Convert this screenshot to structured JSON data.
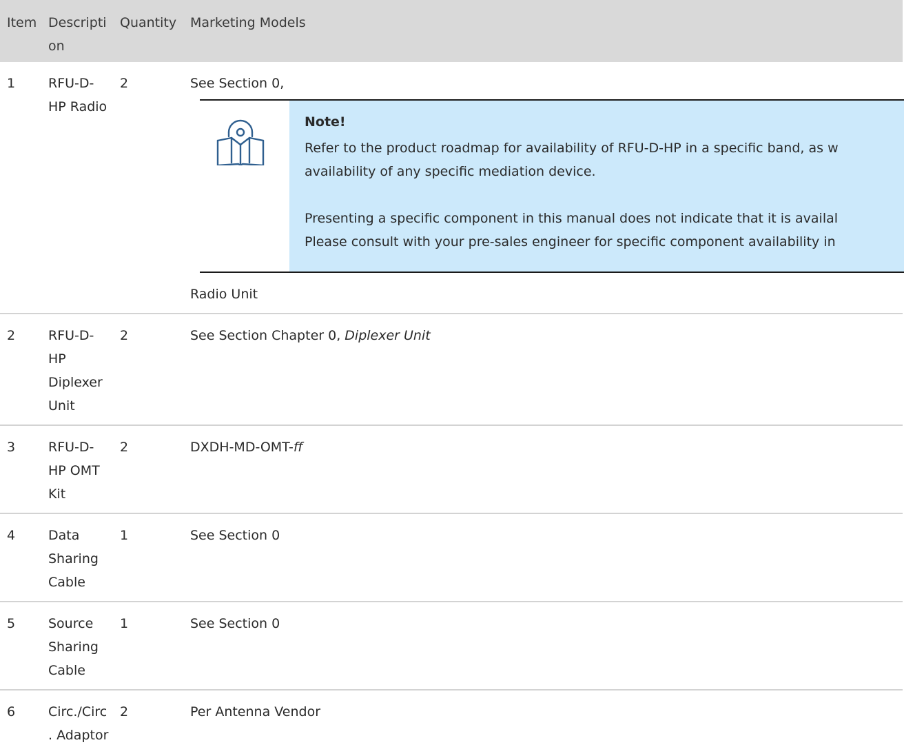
{
  "table": {
    "headers": {
      "item": "Item",
      "description": "Description",
      "quantity": "Quantity",
      "models": "Marketing Models"
    },
    "rows": [
      {
        "item": "1",
        "description": "RFU-D-HP Radio",
        "quantity": "2",
        "models_before": "See Section 0,",
        "models_after": "Radio Unit"
      },
      {
        "item": "2",
        "description": "RFU-D-HP Diplexer Unit",
        "quantity": "2",
        "models_plain": "See Section Chapter 0, ",
        "models_italic": "Diplexer Unit"
      },
      {
        "item": "3",
        "description": "RFU-D-HP OMT Kit",
        "quantity": "2",
        "models_plain": "DXDH-MD-OMT-",
        "models_italic": "ff"
      },
      {
        "item": "4",
        "description": "Data Sharing Cable",
        "quantity": "1",
        "models": "See Section 0"
      },
      {
        "item": "5",
        "description": "Source Sharing Cable",
        "quantity": "1",
        "models": "See Section 0"
      },
      {
        "item": "6",
        "description": "Circ./Circ. Adaptor",
        "quantity": "2",
        "models": "Per Antenna Vendor"
      }
    ]
  },
  "note": {
    "icon": "open-book-cd-icon",
    "title": "Note!",
    "line1": "Refer to the product roadmap for availability of RFU-D-HP in a specific band, as w",
    "line2": "availability of any specific mediation device.",
    "line3": "Presenting a specific component in this manual does not indicate that it is availal",
    "line4": "Please consult with your pre-sales engineer for specific component availability in",
    "background": "#cce9fb"
  },
  "colors": {
    "header_bg": "#d9d9d9",
    "row_divider": "#d3d3d3",
    "icon_stroke": "#2f5f8f"
  }
}
